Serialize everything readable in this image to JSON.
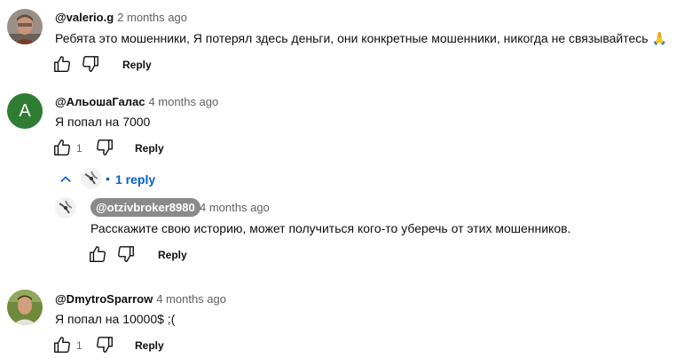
{
  "colors": {
    "accent": "#065fd4",
    "avatar_letter_bg": "#2e7d32",
    "pill_bg": "#8a8a8a"
  },
  "comments": [
    {
      "author": "@valerio.g",
      "time": "2 months ago",
      "text": "Ребята это мошенники, Я потерял здесь деньги, они конкретные мошенники, никогда не связывайтесь 🙏",
      "likes": "",
      "reply_label": "Reply",
      "avatar": "photo-man"
    },
    {
      "author": "@АльошаГалас",
      "time": "4 months ago",
      "text": "Я попал на 7000",
      "likes": "1",
      "reply_label": "Reply",
      "avatar_letter": "A",
      "replies_toggle": "1 reply",
      "replies": [
        {
          "author": "@otzivbroker8980",
          "time": "4 months ago",
          "text": "Расскажите свою историю, может получиться кого-то уберечь от этих мошенников.",
          "reply_label": "Reply",
          "avatar": "bird-logo"
        }
      ]
    },
    {
      "author": "@DmytroSparrow",
      "time": "4 months ago",
      "text": "Я попал на 10000$ ;(",
      "likes": "1",
      "reply_label": "Reply",
      "avatar": "photo-man-outdoor"
    }
  ]
}
